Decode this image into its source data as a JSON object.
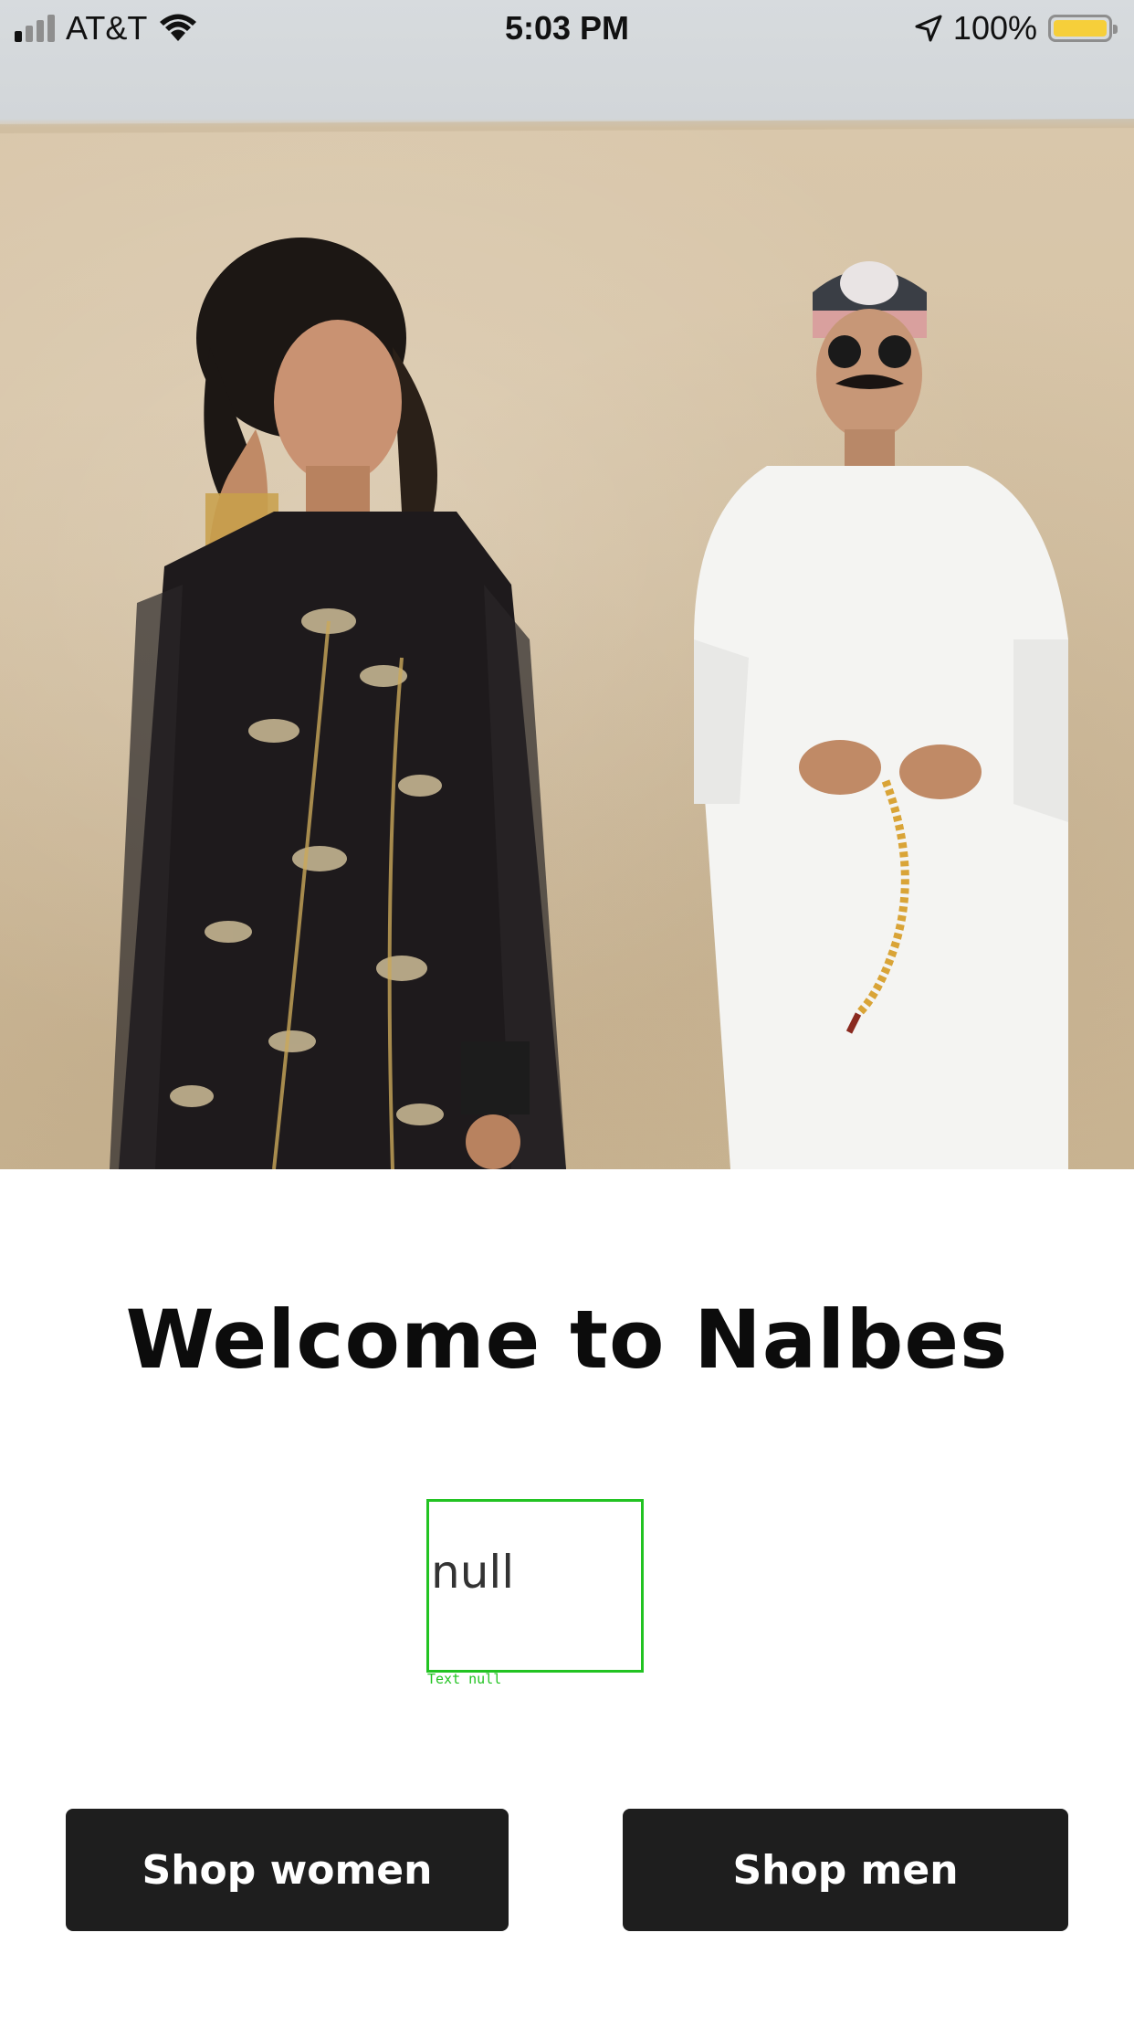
{
  "status_bar": {
    "carrier": "AT&T",
    "time": "5:03 PM",
    "battery_percent": "100%",
    "battery_level": 1.0,
    "icons": [
      "signal-icon",
      "wifi-icon",
      "location-arrow-icon",
      "battery-icon"
    ],
    "battery_color": "#f6cf3a"
  },
  "hero": {
    "image_description_icon": "hero-photo"
  },
  "main": {
    "title": "Welcome to Nalbes",
    "placeholder_text": "null",
    "placeholder_caption": "Text null"
  },
  "buttons": {
    "shop_women": "Shop women",
    "shop_men": "Shop men"
  },
  "colors": {
    "button_bg": "#1e1e1e",
    "button_text": "#ffffff",
    "debug_box": "#22c322"
  }
}
